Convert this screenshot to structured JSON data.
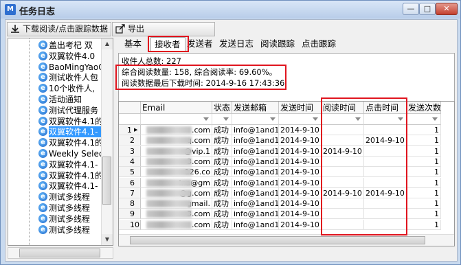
{
  "window": {
    "title": "任务日志",
    "icon": "app-logo-icon"
  },
  "toolbar": {
    "download_label": "下载阅读/点击跟踪数据",
    "export_label": "导出"
  },
  "tree": {
    "items": [
      {
        "label": "盖出考杞  双"
      },
      {
        "label": "双翼软件4.0"
      },
      {
        "label": "BaoMingYaoQi"
      },
      {
        "label": "测试收件人包"
      },
      {
        "label": "10个收件人,"
      },
      {
        "label": "活动通知"
      },
      {
        "label": "测试代理服务"
      },
      {
        "label": "双翼软件4.1的"
      },
      {
        "label": "双翼软件4.1-",
        "selected": true
      },
      {
        "label": "双翼软件4.1的"
      },
      {
        "label": "Weekly Selec"
      },
      {
        "label": "双翼软件4.1-"
      },
      {
        "label": "双翼软件4.1的"
      },
      {
        "label": "双翼软件4.1-"
      },
      {
        "label": "测试多线程"
      },
      {
        "label": "测试多线程"
      },
      {
        "label": "测试多线程"
      },
      {
        "label": "测试多线程"
      }
    ]
  },
  "tabs": [
    {
      "label": "基本"
    },
    {
      "label": "接收者",
      "active": true
    },
    {
      "label": "发送者"
    },
    {
      "label": "发送日志"
    },
    {
      "label": "阅读跟踪"
    },
    {
      "label": "点击跟踪"
    }
  ],
  "summary": {
    "total": "收件人总数: 227",
    "read_stats": "综合阅读数量: 158, 综合阅读率: 69.60%。",
    "last_download": "阅读数据最后下载时间: 2014-9-16 17:43:36"
  },
  "grid": {
    "columns": [
      "Email",
      "状态",
      "发送邮箱",
      "发送时间",
      "阅读时间",
      "点击时间",
      "发送次数"
    ],
    "rows": [
      {
        "num": "1",
        "email": ".com",
        "status": "成功",
        "sender": "info@1and1-",
        "send_time": "2014-9-10",
        "read_time": "",
        "click_time": "",
        "count": "1"
      },
      {
        "num": "2",
        "email": "q.com",
        "status": "成功",
        "sender": "info@1and1-",
        "send_time": "2014-9-10",
        "read_time": "",
        "click_time": "2014-9-10",
        "count": "1"
      },
      {
        "num": "3",
        "email": "@vip.1",
        "status": "成功",
        "sender": "info@1and1-",
        "send_time": "2014-9-10",
        "read_time": "2014-9-10",
        "click_time": "",
        "count": "1"
      },
      {
        "num": "4",
        "email": "3.com",
        "status": "成功",
        "sender": "info@1and1-",
        "send_time": "2014-9-10",
        "read_time": "",
        "click_time": "",
        "count": "1"
      },
      {
        "num": "5",
        "email": "126.co",
        "status": "成功",
        "sender": "info@1and1-",
        "send_time": "2014-9-10",
        "read_time": "",
        "click_time": "",
        "count": "1"
      },
      {
        "num": "6",
        "email": "ina@gm",
        "status": "成功",
        "sender": "info@1and1-",
        "send_time": "2014-9-10",
        "read_time": "",
        "click_time": "",
        "count": "1"
      },
      {
        "num": "7",
        "email": "@g.com",
        "status": "成功",
        "sender": "info@1and1-",
        "send_time": "2014-9-10",
        "read_time": "2014-9-10",
        "click_time": "2014-9-10",
        "count": "1"
      },
      {
        "num": "8",
        "email": "gmail.",
        "status": "成功",
        "sender": "info@1and1-",
        "send_time": "2014-9-10",
        "read_time": "",
        "click_time": "",
        "count": "1"
      },
      {
        "num": "9",
        "email": "3.com",
        "status": "成功",
        "sender": "info@1and1-",
        "send_time": "2014-9-10",
        "read_time": "",
        "click_time": "",
        "count": "1"
      },
      {
        "num": "10",
        "email": ".com",
        "status": "成功",
        "sender": "info@1and1-",
        "send_time": "2014-9-10",
        "read_time": "",
        "click_time": "",
        "count": "1"
      }
    ]
  },
  "colors": {
    "highlight": "#e0141e",
    "selection": "#3399ff",
    "titlebar": "#c9daef"
  }
}
